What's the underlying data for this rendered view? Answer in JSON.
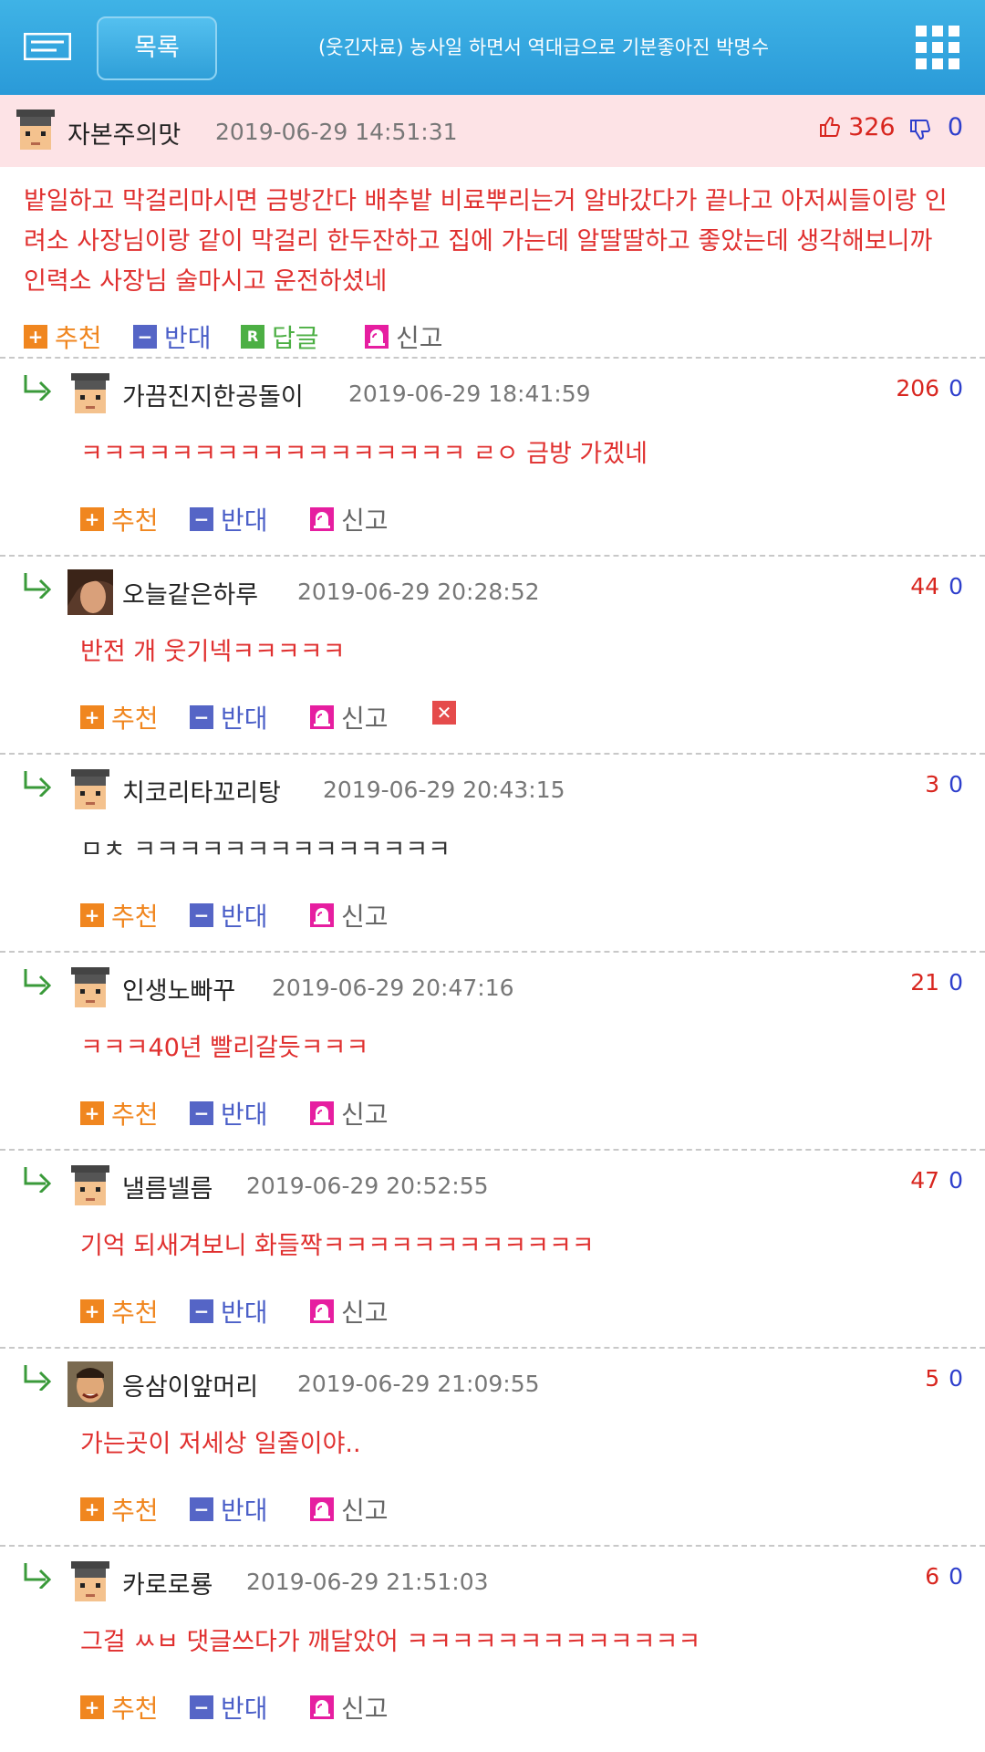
{
  "header": {
    "list_label": "목록",
    "title": "(웃긴자료) 농사일 하면서 역대급으로 기분좋아진 박명수"
  },
  "post": {
    "author": "자본주의맛",
    "date": "2019-06-29 14:51:31",
    "up": "326",
    "down": "0",
    "body": "밭일하고 막걸리마시면 금방간다 배추밭 비료뿌리는거 알바갔다가 끝나고 아저씨들이랑 인려소 사장님이랑 같이 막걸리 한두잔하고 집에 가는데 알딸딸하고 좋았는데 생각해보니까 인력소 사장님 술마시고 운전하셨네",
    "actions": {
      "recommend": "추천",
      "oppose": "반대",
      "reply": "답글",
      "report": "신고"
    }
  },
  "comment_actions": {
    "recommend": "추천",
    "oppose": "반대",
    "report": "신고"
  },
  "comments": [
    {
      "author": "가끔진지한공돌이",
      "date": "2019-06-29 18:41:59",
      "up": "206",
      "down": "0",
      "text": "ㅋㅋㅋㅋㅋㅋㅋㅋㅋㅋㅋㅋㅋㅋㅋㅋㅋ ㄹㅇ 금방 가겠네"
    },
    {
      "author": "오늘같은하루",
      "date": "2019-06-29 20:28:52",
      "up": "44",
      "down": "0",
      "text": "반전 개 웃기넥ㅋㅋㅋㅋㅋ"
    },
    {
      "author": "치코리타꼬리탕",
      "date": "2019-06-29 20:43:15",
      "up": "3",
      "down": "0",
      "text": "ㅁㅊ ㅋㅋㅋㅋㅋㅋㅋㅋㅋㅋㅋㅋㅋㅋ"
    },
    {
      "author": "인생노빠꾸",
      "date": "2019-06-29 20:47:16",
      "up": "21",
      "down": "0",
      "text": "ㅋㅋㅋ40년 빨리갈듯ㅋㅋㅋ"
    },
    {
      "author": "낼름넬름",
      "date": "2019-06-29 20:52:55",
      "up": "47",
      "down": "0",
      "text": "기억 되새겨보니 화들짝ㅋㅋㅋㅋㅋㅋㅋㅋㅋㅋㅋㅋ"
    },
    {
      "author": "응삼이앞머리",
      "date": "2019-06-29 21:09:55",
      "up": "5",
      "down": "0",
      "text": "가는곳이 저세상 일줄이야.."
    },
    {
      "author": "카로로룡",
      "date": "2019-06-29 21:51:03",
      "up": "6",
      "down": "0",
      "text": "그걸 ㅆㅂ 댓글쓰다가 깨달았어 ㅋㅋㅋㅋㅋㅋㅋㅋㅋㅋㅋㅋㅋ"
    }
  ]
}
